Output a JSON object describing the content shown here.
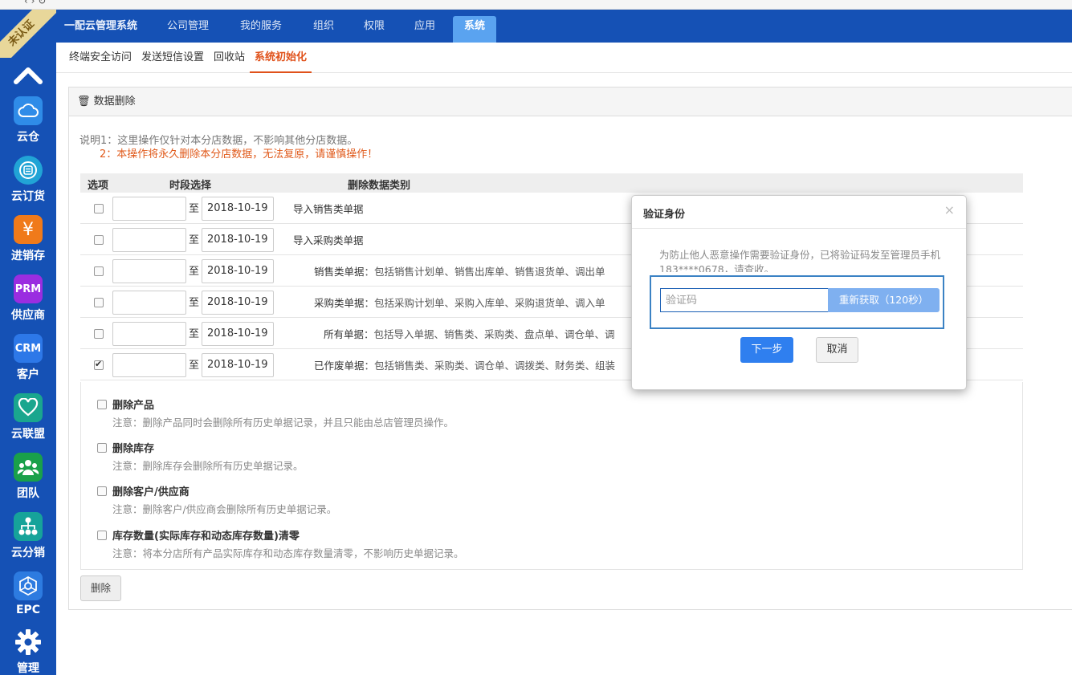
{
  "sidebar": {
    "badge": "未认证",
    "items": [
      {
        "label": "云仓",
        "icon": "cloud-icon",
        "color": "#2f8ce8",
        "text": ""
      },
      {
        "label": "云订货",
        "icon": "order-icon",
        "color": "#21a4d6",
        "text": ""
      },
      {
        "label": "进销存",
        "icon": "yen-icon",
        "color": "#f07a1a",
        "text": "¥"
      },
      {
        "label": "供应商",
        "icon": "prm-icon",
        "color": "#9a2de0",
        "text": "PRM"
      },
      {
        "label": "客户",
        "icon": "crm-icon",
        "color": "#2d78e8",
        "text": "CRM"
      },
      {
        "label": "云联盟",
        "icon": "heart-hands-icon",
        "color": "#1aa68e",
        "text": ""
      },
      {
        "label": "团队",
        "icon": "team-icon",
        "color": "#19a04a",
        "text": ""
      },
      {
        "label": "云分销",
        "icon": "distribution-icon",
        "color": "#16a39a",
        "text": ""
      },
      {
        "label": "EPC",
        "icon": "epc-icon",
        "color": "#2d7be0",
        "text": ""
      },
      {
        "label": "管理",
        "icon": "gear-icon",
        "color": "#1551b5",
        "text": ""
      }
    ]
  },
  "topnav": {
    "tabs": [
      "一配云管理系统",
      "公司管理",
      "我的服务",
      "组织",
      "权限",
      "应用",
      "系统"
    ],
    "active": "系统"
  },
  "subnav": {
    "items": [
      "终端安全访问",
      "发送短信设置",
      "回收站",
      "系统初始化"
    ],
    "active": "系统初始化"
  },
  "panel": {
    "title": "🗑 数据删除",
    "note1": "说明1：这里操作仅针对本分店数据，不影响其他分店数据。",
    "note2": "2：本操作将永久删除本分店数据，无法复原，请谨慎操作！",
    "headers": {
      "option": "选项",
      "period": "时段选择",
      "category": "删除数据类别"
    },
    "zhi": "至",
    "rows": [
      {
        "date": "2018-10-19",
        "bold": "导入销售类单据",
        "desc": "",
        "checked": false
      },
      {
        "date": "2018-10-19",
        "bold": "导入采购类单据",
        "desc": "",
        "checked": false
      },
      {
        "date": "2018-10-19",
        "bold": "销售类单据",
        "desc": "：包括销售计划单、销售出库单、销售退货单、调出单",
        "checked": false
      },
      {
        "date": "2018-10-19",
        "bold": "采购类单据",
        "desc": "：包括采购计划单、采购入库单、采购退货单、调入单",
        "checked": false
      },
      {
        "date": "2018-10-19",
        "bold": "所有单据",
        "desc": "：包括导入单据、销售类、采购类、盘点单、调仓单、调",
        "checked": false
      },
      {
        "date": "2018-10-19",
        "bold": "已作废单据",
        "desc": "：包括销售类、采购类、调仓单、调拨类、财务类、组装",
        "checked": true
      }
    ],
    "options": [
      {
        "title": "删除产品",
        "note": "注意：删除产品同时会删除所有历史单据记录，并且只能由总店管理员操作。"
      },
      {
        "title": "删除库存",
        "note": "注意：删除库存会删除所有历史单据记录。"
      },
      {
        "title": "删除客户/供应商",
        "note": "注意：删除客户/供应商会删除所有历史单据记录。"
      },
      {
        "title": "库存数量(实际库存和动态库存数量)清零",
        "note": "注意：将本分店所有产品实际库存和动态库存数量清零，不影响历史单据记录。"
      }
    ],
    "delete_label": "删除"
  },
  "modal": {
    "title": "验证身份",
    "close": "×",
    "message": "为防止他人恶意操作需要验证身份，已将验证码发至管理员手机183****0678，请查收。",
    "code_placeholder": "验证码",
    "resend_label": "重新获取（120秒）",
    "next_label": "下一步",
    "cancel_label": "取消"
  }
}
